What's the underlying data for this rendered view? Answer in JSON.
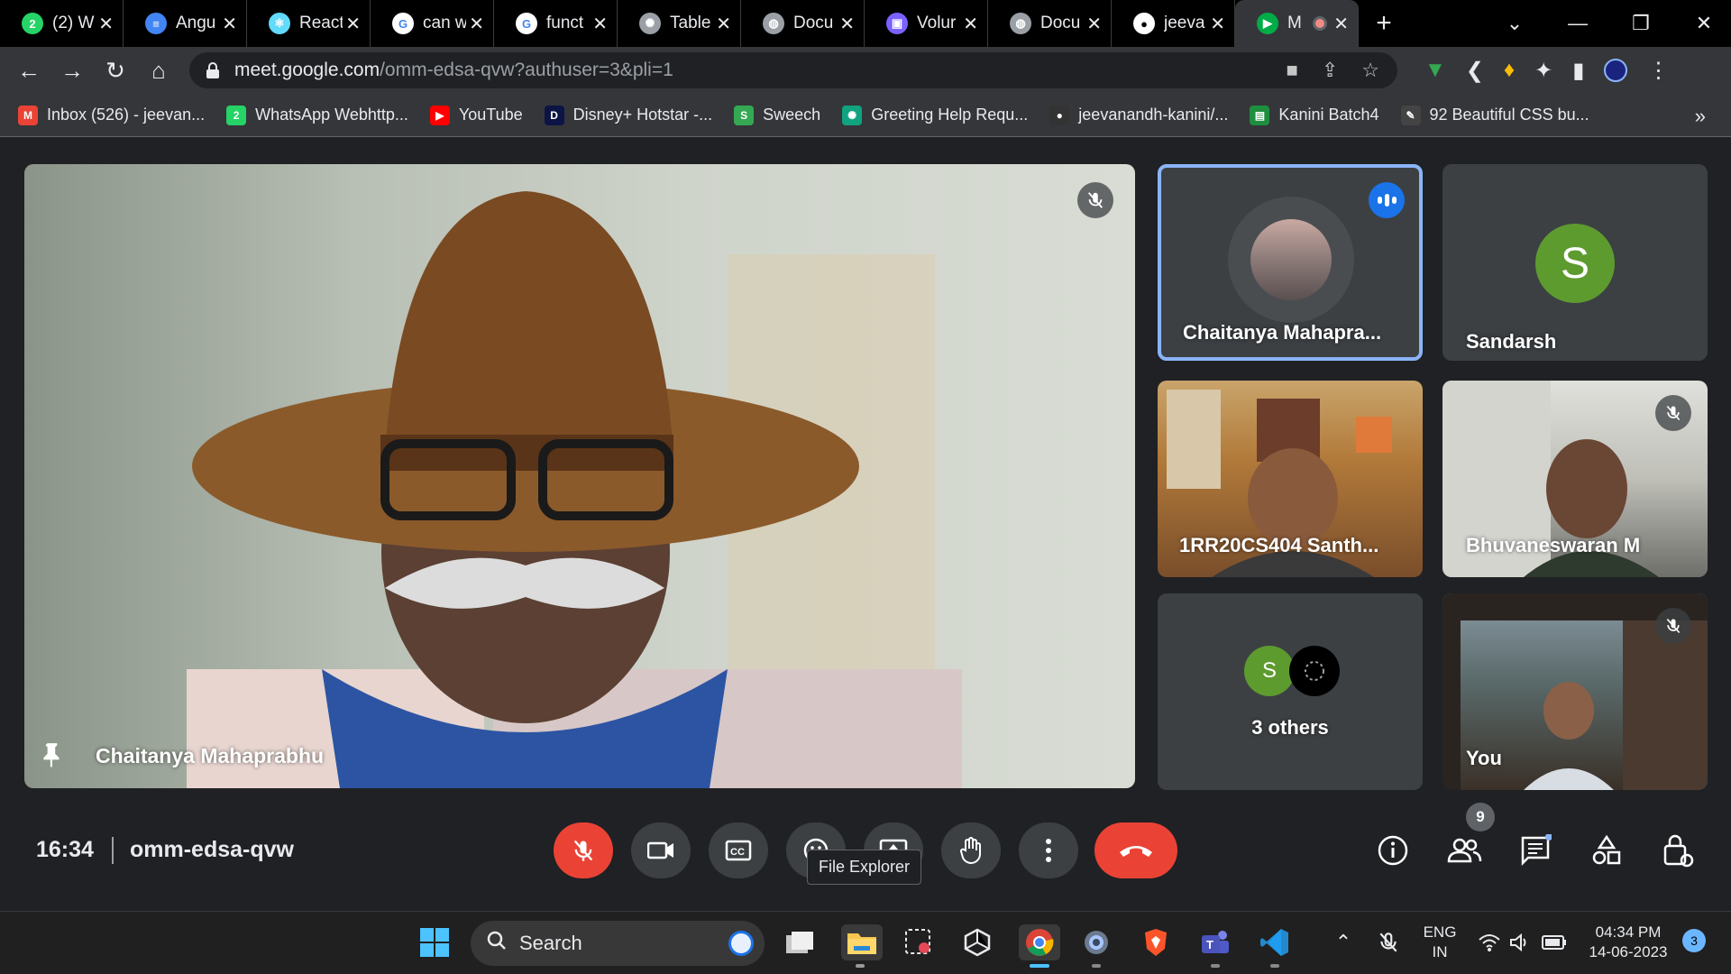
{
  "tabs": [
    {
      "label": "(2) W",
      "icon": "whatsapp-icon",
      "color": "#25d366",
      "glyph": "2"
    },
    {
      "label": "Angu",
      "icon": "docs-icon",
      "color": "#4285f4",
      "glyph": "≡"
    },
    {
      "label": "React",
      "icon": "react-icon",
      "color": "#61dafb",
      "glyph": "⚛"
    },
    {
      "label": "can w",
      "icon": "google-icon",
      "color": "#ffffff",
      "glyph": "G"
    },
    {
      "label": "funct",
      "icon": "google-icon",
      "color": "#ffffff",
      "glyph": "G"
    },
    {
      "label": "Table",
      "icon": "chatgpt-icon",
      "color": "#9aa0a6",
      "glyph": "✺"
    },
    {
      "label": "Docu",
      "icon": "globe-icon",
      "color": "#9aa0a6",
      "glyph": "◍"
    },
    {
      "label": "Volur",
      "icon": "canva-icon",
      "color": "#7b61ff",
      "glyph": "▣"
    },
    {
      "label": "Docu",
      "icon": "globe-icon",
      "color": "#9aa0a6",
      "glyph": "◍"
    },
    {
      "label": "jeeva",
      "icon": "github-icon",
      "color": "#ffffff",
      "glyph": "●"
    },
    {
      "label": "M",
      "icon": "meet-icon",
      "color": "#00ac47",
      "glyph": "▶"
    }
  ],
  "address": {
    "host": "meet.google.com",
    "path": "/omm-edsa-qvw?authuser=3&pli=1"
  },
  "bookmarks": [
    {
      "label": "Inbox (526) - jeevan...",
      "icon": "gmail-icon",
      "color": "#ea4335",
      "glyph": "M"
    },
    {
      "label": "WhatsApp Webhttp...",
      "icon": "whatsapp-icon",
      "color": "#25d366",
      "glyph": "2"
    },
    {
      "label": "YouTube",
      "icon": "youtube-icon",
      "color": "#ff0000",
      "glyph": "▶"
    },
    {
      "label": "Disney+ Hotstar -...",
      "icon": "hotstar-icon",
      "color": "#0c1445",
      "glyph": "D"
    },
    {
      "label": "Sweech",
      "icon": "sweech-icon",
      "color": "#34a853",
      "glyph": "S"
    },
    {
      "label": "Greeting Help Requ...",
      "icon": "chatgpt-icon",
      "color": "#10a37f",
      "glyph": "✺"
    },
    {
      "label": "jeevanandh-kanini/...",
      "icon": "github-icon",
      "color": "#333333",
      "glyph": "●"
    },
    {
      "label": "Kanini Batch4",
      "icon": "classroom-icon",
      "color": "#1e8e3e",
      "glyph": "▤"
    },
    {
      "label": "92 Beautiful CSS bu...",
      "icon": "css-icon",
      "color": "#444444",
      "glyph": "✎"
    }
  ],
  "bookmarks_more": "»",
  "tiles": {
    "main": {
      "name": "Chaitanya Mahaprabhu"
    },
    "t1": {
      "name": "Chaitanya Mahapra..."
    },
    "t2": {
      "name": "Sandarsh",
      "initial": "S"
    },
    "t3": {
      "name": "1RR20CS404 Santh..."
    },
    "t4": {
      "name": "Bhuvaneswaran M"
    },
    "t5": {
      "name": "3 others",
      "initial": "S"
    },
    "t6": {
      "name": "You"
    }
  },
  "meeting": {
    "time": "16:34",
    "code": "omm-edsa-qvw",
    "participants_count": "9"
  },
  "tooltip": "File Explorer",
  "taskbar": {
    "search": "Search",
    "lang1": "ENG",
    "lang2": "IN",
    "time": "04:34 PM",
    "date": "14-06-2023",
    "notifications": "3"
  },
  "colors": {
    "accent": "#8ab4f8",
    "hangup": "#ea4335",
    "avatar_green": "#5e9b2f"
  }
}
